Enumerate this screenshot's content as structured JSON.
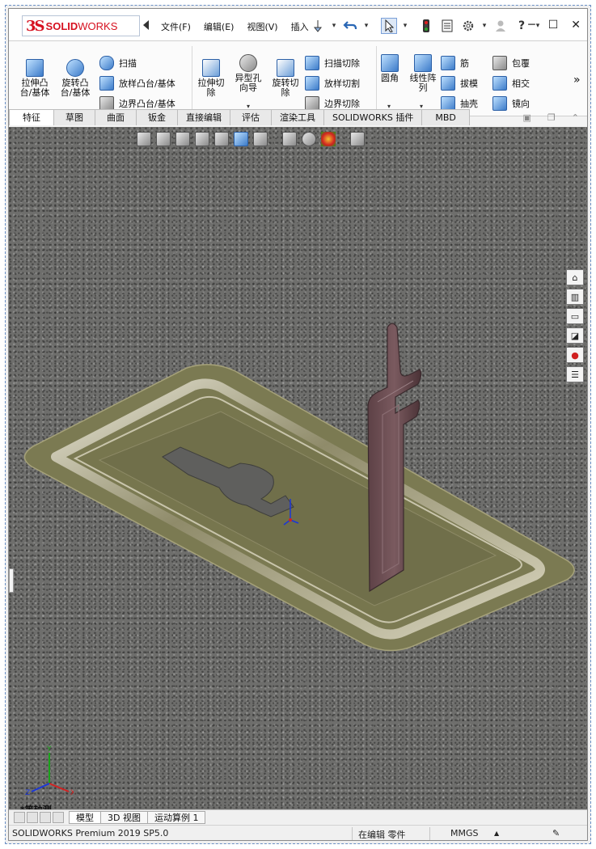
{
  "app": {
    "logo_ds": "3S",
    "logo_name_bold": "SOLID",
    "logo_name_rest": "WORKS"
  },
  "menu": {
    "file": "文件(F)",
    "edit": "编辑(E)",
    "view": "视图(V)",
    "insert": "插入"
  },
  "ribbon": {
    "extrude_boss": "拉伸凸\n台/基体",
    "revolve_boss": "旋转凸\n台/基体",
    "sweep": "扫描",
    "loft_boss": "放样凸台/基体",
    "boundary_boss": "边界凸台/基体",
    "extrude_cut": "拉伸切\n除",
    "hole_wizard": "异型孔\n向导",
    "revolve_cut": "旋转切\n除",
    "sweep_cut": "扫描切除",
    "loft_cut": "放样切割",
    "boundary_cut": "边界切除",
    "fillet": "圆角",
    "linear_pattern": "线性阵\n列",
    "rib": "筋",
    "draft": "拔模",
    "shell": "抽壳",
    "wrap": "包覆",
    "intersect": "相交",
    "mirror": "镜向",
    "more": "»"
  },
  "tabs": [
    "特征",
    "草图",
    "曲面",
    "钣金",
    "直接编辑",
    "评估",
    "渲染工具",
    "SOLIDWORKS 插件",
    "MBD"
  ],
  "active_tab": "特征",
  "view": {
    "orientation_label": "*等轴测"
  },
  "bottom_tabs": [
    "模型",
    "3D 视图",
    "运动算例 1"
  ],
  "active_bottom_tab": "模型",
  "status": {
    "product": "SOLIDWORKS Premium 2019 SP5.0",
    "mode": "在编辑 零件",
    "units": "MMGS",
    "units_arrow": "▲"
  },
  "colors": {
    "brand_red": "#d6101f",
    "viewport_gray": "#6e6e6c",
    "part_olive": "#7b7a52",
    "part_maroon": "#6a4a4e"
  }
}
